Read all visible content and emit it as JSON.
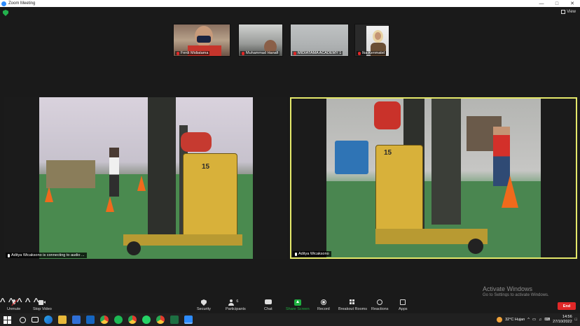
{
  "window": {
    "title": "Zoom Meeting"
  },
  "view_label": "View",
  "participants_strip": [
    {
      "name": "Ferdi Midiatama"
    },
    {
      "name": "Muhammad Hanafi"
    },
    {
      "name": "MIDIATAMA ACADEMY 1"
    },
    {
      "name": "Ika Kenmatel"
    }
  ],
  "main_videos": [
    {
      "label": "Aditya Wicaksono is connecting to audio ...",
      "forklift_number": "15"
    },
    {
      "label": "Aditya Wicaksono",
      "forklift_number": "15",
      "active_speaker": true
    }
  ],
  "activation": {
    "title": "Activate Windows",
    "subtitle": "Go to Settings to activate Windows."
  },
  "toolbar": {
    "unmute": "Unmute",
    "stop_video": "Stop Video",
    "security": "Security",
    "participants": "Participants",
    "participants_count": "6",
    "chat": "Chat",
    "share_screen": "Share Screen",
    "record": "Record",
    "breakout_rooms": "Breakout Rooms",
    "reactions": "Reactions",
    "apps": "Apps",
    "end": "End"
  },
  "taskbar": {
    "weather": "32°C  Hujan",
    "time": "14:56",
    "date": "27/10/2022"
  },
  "colors": {
    "active_speaker_border": "#e4e86a",
    "end_button": "#e02828",
    "share_screen": "#1fb141"
  }
}
